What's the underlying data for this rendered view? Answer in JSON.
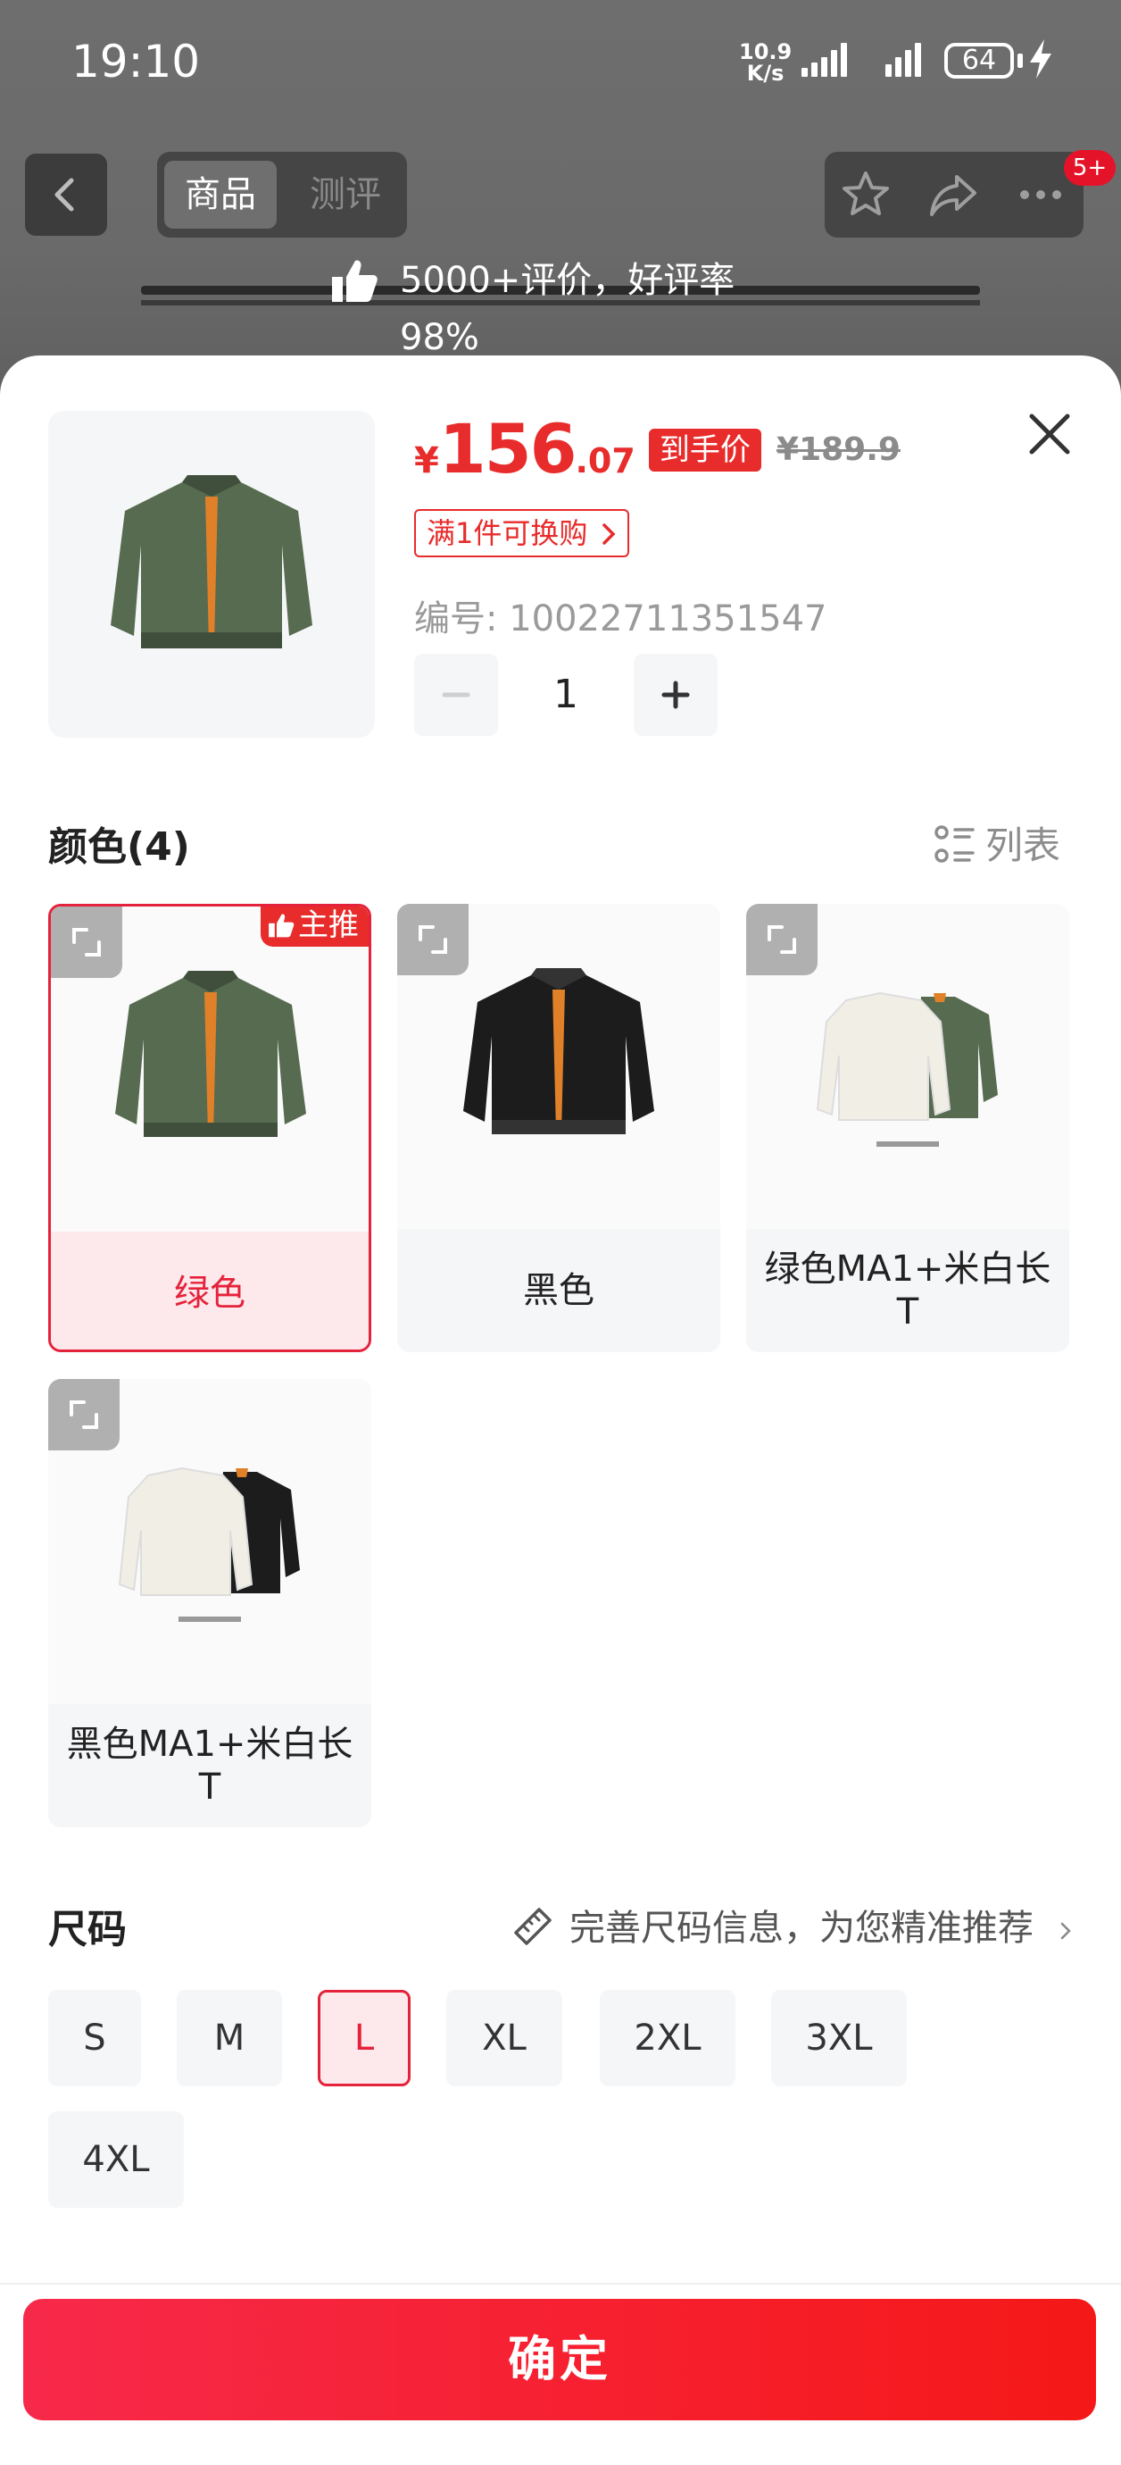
{
  "status_bar": {
    "time": "19:10",
    "net_speed_value": "10.9",
    "net_speed_unit": "K/s",
    "battery": "64"
  },
  "header": {
    "tabs": [
      {
        "label": "商品",
        "active": true
      },
      {
        "label": "测评",
        "active": false
      }
    ],
    "badge": "5+",
    "rating_text": "5000+评价，好评率98%"
  },
  "product": {
    "price_symbol": "¥",
    "price_integer": "156",
    "price_decimal": ".07",
    "price_tag": "到手价",
    "original_price": "¥189.9",
    "promo": "满1件可换购",
    "sku_number": "编号: 10022711351547",
    "quantity": "1"
  },
  "color_section": {
    "title": "颜色(4)",
    "list_toggle": "列表",
    "recommend_tag": "主推",
    "options": [
      {
        "label": "绿色",
        "selected": true
      },
      {
        "label": "黑色",
        "selected": false
      },
      {
        "label": "绿色MA1+米白长T",
        "selected": false
      },
      {
        "label": "黑色MA1+米白长T",
        "selected": false
      }
    ]
  },
  "size_section": {
    "title": "尺码",
    "hint": "完善尺码信息，为您精准推荐",
    "options": [
      {
        "label": "S",
        "selected": false
      },
      {
        "label": "M",
        "selected": false
      },
      {
        "label": "L",
        "selected": true
      },
      {
        "label": "XL",
        "selected": false
      },
      {
        "label": "2XL",
        "selected": false
      },
      {
        "label": "3XL",
        "selected": false
      },
      {
        "label": "4XL",
        "selected": false
      }
    ]
  },
  "footer": {
    "confirm_label": "确定"
  },
  "colors": {
    "accent_red": "#e82b2b",
    "selected_bg": "#fde9ec",
    "green_jacket": "#566b50",
    "black_jacket": "#1c1c1c",
    "lining_orange": "#e0812a"
  }
}
